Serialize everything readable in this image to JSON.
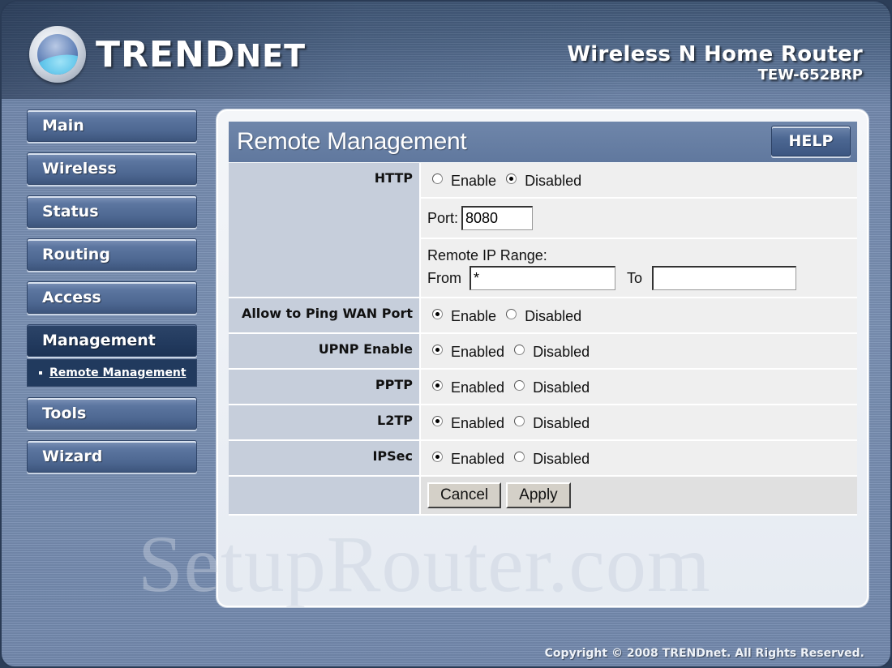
{
  "brand": {
    "logo_text_upper": "TREND",
    "logo_text_lower": "net",
    "product_name": "Wireless N Home Router",
    "model": "TEW-652BRP"
  },
  "sidebar": {
    "items": [
      {
        "label": "Main",
        "active": false
      },
      {
        "label": "Wireless",
        "active": false
      },
      {
        "label": "Status",
        "active": false
      },
      {
        "label": "Routing",
        "active": false
      },
      {
        "label": "Access",
        "active": false
      },
      {
        "label": "Management",
        "active": true
      },
      {
        "label": "Tools",
        "active": false
      },
      {
        "label": "Wizard",
        "active": false
      }
    ],
    "subitem": "Remote Management"
  },
  "panel": {
    "title": "Remote Management",
    "help_label": "HELP"
  },
  "form": {
    "http": {
      "label": "HTTP",
      "options": [
        "Enable",
        "Disabled"
      ],
      "selected": "Disabled",
      "port_label": "Port:",
      "port_value": "8080",
      "range_label": "Remote IP Range:",
      "from_label": "From",
      "from_value": "*",
      "to_label": "To",
      "to_value": ""
    },
    "ping": {
      "label": "Allow to Ping WAN Port",
      "options": [
        "Enable",
        "Disabled"
      ],
      "selected": "Enable"
    },
    "upnp": {
      "label": "UPNP Enable",
      "options": [
        "Enabled",
        "Disabled"
      ],
      "selected": "Enabled"
    },
    "pptp": {
      "label": "PPTP",
      "options": [
        "Enabled",
        "Disabled"
      ],
      "selected": "Enabled"
    },
    "l2tp": {
      "label": "L2TP",
      "options": [
        "Enabled",
        "Disabled"
      ],
      "selected": "Enabled"
    },
    "ipsec": {
      "label": "IPSec",
      "options": [
        "Enabled",
        "Disabled"
      ],
      "selected": "Enabled"
    },
    "cancel_label": "Cancel",
    "apply_label": "Apply"
  },
  "watermark": "SetupRouter.com",
  "footer": {
    "copyright": "Copyright © 2008 TRENDnet. All Rights Reserved."
  },
  "colors": {
    "frame_blue": "#7a90b3",
    "nav_button": "#4c6690",
    "nav_active": "#223a5e",
    "header_bar": "#60789e",
    "label_cell": "#c6cedb",
    "value_cell": "#efefef"
  }
}
